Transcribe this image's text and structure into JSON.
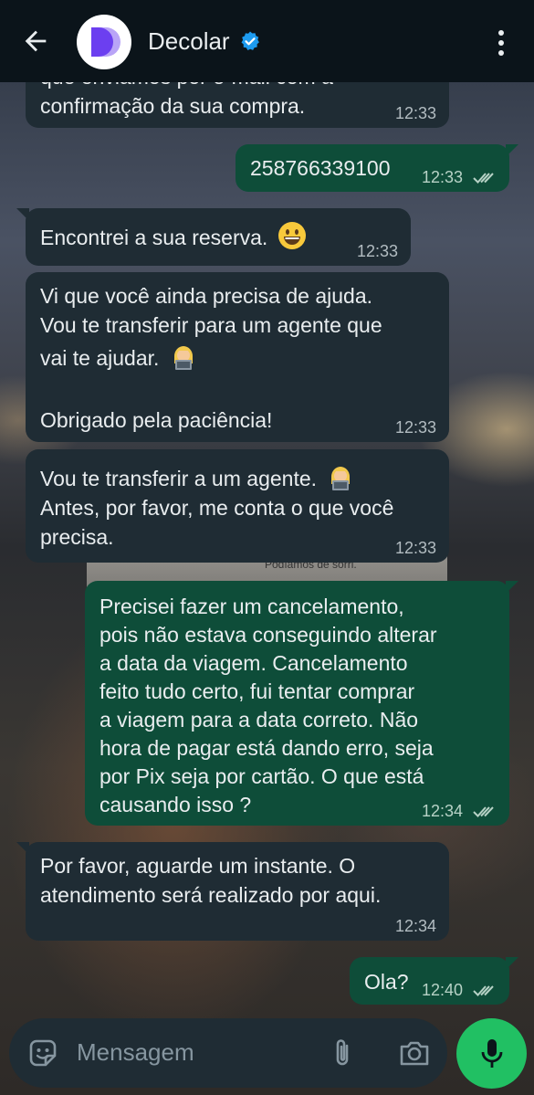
{
  "header": {
    "contact_name": "Decolar",
    "verified": true,
    "avatar_letter": "D"
  },
  "messages": [
    {
      "dir": "in",
      "text_lines": [
        "que enviamos por e-mail com a",
        "confirmação da sua compra."
      ],
      "time": "12:33"
    },
    {
      "dir": "out",
      "text": "258766339100",
      "time": "12:33",
      "read": true
    },
    {
      "dir": "in",
      "text": "Encontrei a sua reserva.",
      "emoji": "grinning-face",
      "time": "12:33"
    },
    {
      "dir": "in",
      "text_lines": [
        "Vi que você ainda precisa de ajuda.",
        "Vou te transferir para um agente que",
        "vai te ajudar.",
        "",
        "Obrigado pela paciência!"
      ],
      "emoji": "woman-technologist",
      "time": "12:33"
    },
    {
      "dir": "in",
      "text_lines": [
        "Vou te transferir a um agente.",
        "Antes, por favor, me conta o que você",
        "precisa."
      ],
      "emoji": "woman-technologist",
      "time": "12:33"
    },
    {
      "dir": "out",
      "text_lines": [
        "Precisei fazer um cancelamento,",
        "pois não estava conseguindo alterar",
        "a data da viagem. Cancelamento",
        "feito tudo certo, fui tentar comprar",
        "a viagem para a data correto. Não",
        "hora de pagar está dando erro, seja",
        "por Pix seja por cartão. O que está",
        "causando isso ?"
      ],
      "time": "12:34",
      "read": true
    },
    {
      "dir": "in",
      "text_lines": [
        "Por favor, aguarde um instante. O",
        "atendimento será realizado por aqui."
      ],
      "time": "12:34"
    },
    {
      "dir": "out",
      "text": "Ola?",
      "time": "12:40",
      "read": true
    }
  ],
  "background_text": "Podíamos de sorri.",
  "composer": {
    "placeholder": "Mensagem",
    "icons": [
      "sticker-icon",
      "attach-icon",
      "camera-icon",
      "mic-icon"
    ]
  },
  "colors": {
    "header_bg": "#0b141a",
    "incoming_bubble": "#1f2c34",
    "outgoing_bubble": "#0e4d39",
    "mic_button": "#21c063",
    "verified_badge": "#1d9bf0",
    "brand_purple": "#6c3ff0"
  }
}
